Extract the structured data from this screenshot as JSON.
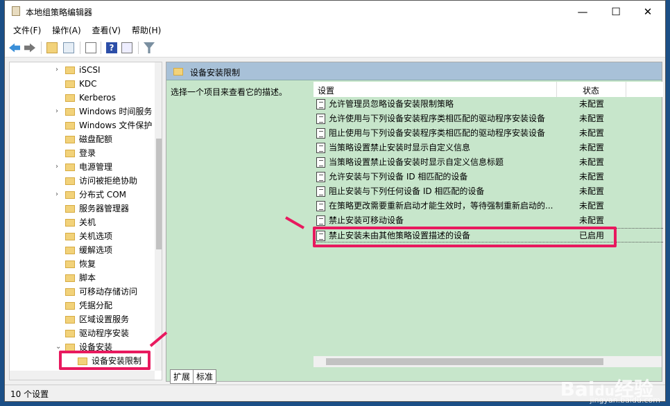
{
  "window": {
    "title": "本地组策略编辑器",
    "minimize": "—",
    "maximize": "☐",
    "close": "✕"
  },
  "menu": [
    "文件(F)",
    "操作(A)",
    "查看(V)",
    "帮助(H)"
  ],
  "toolbar": [
    "back-icon",
    "forward-icon",
    "up-folder-icon",
    "show-hide-tree-icon",
    "export-list-icon",
    "help-icon",
    "show-action-pane-icon",
    "filter-icon"
  ],
  "tree": [
    {
      "label": "iSCSI",
      "expand": true
    },
    {
      "label": "KDC"
    },
    {
      "label": "Kerberos"
    },
    {
      "label": "Windows 时间服务",
      "expand": true
    },
    {
      "label": "Windows 文件保护"
    },
    {
      "label": "磁盘配额"
    },
    {
      "label": "登录"
    },
    {
      "label": "电源管理",
      "expand": true
    },
    {
      "label": "访问被拒绝协助"
    },
    {
      "label": "分布式 COM",
      "expand": true
    },
    {
      "label": "服务器管理器"
    },
    {
      "label": "关机"
    },
    {
      "label": "关机选项"
    },
    {
      "label": "缓解选项"
    },
    {
      "label": "恢复"
    },
    {
      "label": "脚本"
    },
    {
      "label": "可移动存储访问"
    },
    {
      "label": "凭据分配"
    },
    {
      "label": "区域设置服务"
    },
    {
      "label": "驱动程序安装"
    },
    {
      "label": "设备安装",
      "expanded": true
    },
    {
      "label": "设备安装限制",
      "child": true,
      "selected": true
    }
  ],
  "right": {
    "header": "设备安装限制",
    "description": "选择一个项目来查看它的描述。",
    "columns": {
      "setting": "设置",
      "state": "状态"
    },
    "rows": [
      {
        "name": "允许管理员忽略设备安装限制策略",
        "state": "未配置"
      },
      {
        "name": "允许使用与下列设备安装程序类相匹配的驱动程序安装设备",
        "state": "未配置"
      },
      {
        "name": "阻止使用与下列设备安装程序类相匹配的驱动程序安装设备",
        "state": "未配置"
      },
      {
        "name": "当策略设置禁止安装时显示自定义信息",
        "state": "未配置"
      },
      {
        "name": "当策略设置禁止设备安装时显示自定义信息标题",
        "state": "未配置"
      },
      {
        "name": "允许安装与下列设备 ID 相匹配的设备",
        "state": "未配置"
      },
      {
        "name": "阻止安装与下列任何设备 ID 相匹配的设备",
        "state": "未配置"
      },
      {
        "name": "在策略更改需要重新启动才能生效时，等待强制重新启动的...",
        "state": "未配置"
      },
      {
        "name": "禁止安装可移动设备",
        "state": "未配置"
      },
      {
        "name": "禁止安装未由其他策略设置描述的设备",
        "state": "已启用",
        "selected": true
      }
    ]
  },
  "tabs": [
    "扩展",
    "标准"
  ],
  "status": "10 个设置",
  "watermark": {
    "text": "Baidu经验",
    "url": "jingyan.baidu.com"
  },
  "colors": {
    "highlight": "#e8195e",
    "pane": "#c7e6cb",
    "header": "#a8c1d8"
  }
}
